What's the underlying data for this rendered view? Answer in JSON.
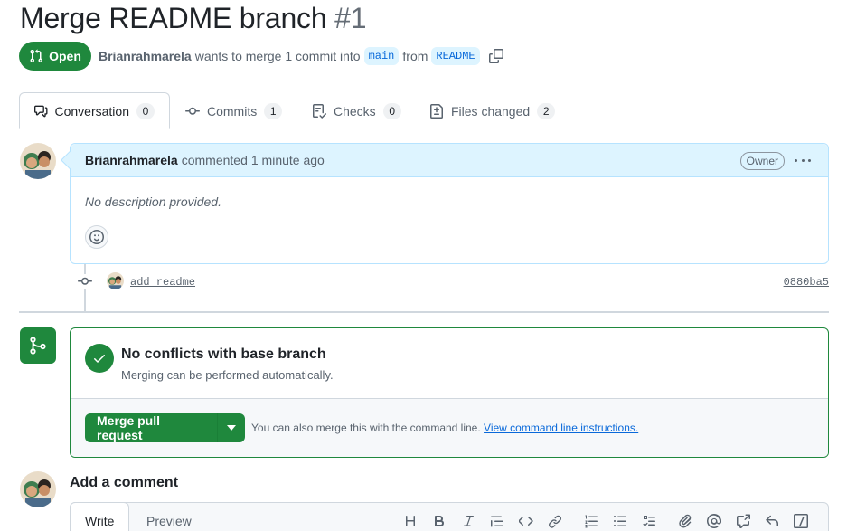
{
  "pr": {
    "title": "Merge README branch",
    "number": "#1",
    "state": "Open",
    "author": "Brianrahmarela",
    "wants_text": "wants to merge 1 commit into",
    "base_branch": "main",
    "from_text": "from",
    "head_branch": "README"
  },
  "tabs": [
    {
      "label": "Conversation",
      "count": "0",
      "icon": "comment-discussion-icon"
    },
    {
      "label": "Commits",
      "count": "1",
      "icon": "git-commit-icon"
    },
    {
      "label": "Checks",
      "count": "0",
      "icon": "checklist-icon"
    },
    {
      "label": "Files changed",
      "count": "2",
      "icon": "file-diff-icon"
    }
  ],
  "comment": {
    "author": "Brianrahmarela",
    "action": "commented",
    "time": "1 minute ago",
    "role_badge": "Owner",
    "body": "No description provided."
  },
  "commit": {
    "message": "add readme",
    "sha": "0880ba5"
  },
  "merge": {
    "title": "No conflicts with base branch",
    "subtitle": "Merging can be performed automatically.",
    "button_label": "Merge pull request",
    "hint": "You can also merge this with the command line.",
    "hint_link": "View command line instructions."
  },
  "add_comment": {
    "title": "Add a comment",
    "write_tab": "Write",
    "preview_tab": "Preview"
  },
  "colors": {
    "open_green": "#1f883d",
    "link_blue": "#0969da",
    "comment_header_bg": "#ddf4ff"
  }
}
